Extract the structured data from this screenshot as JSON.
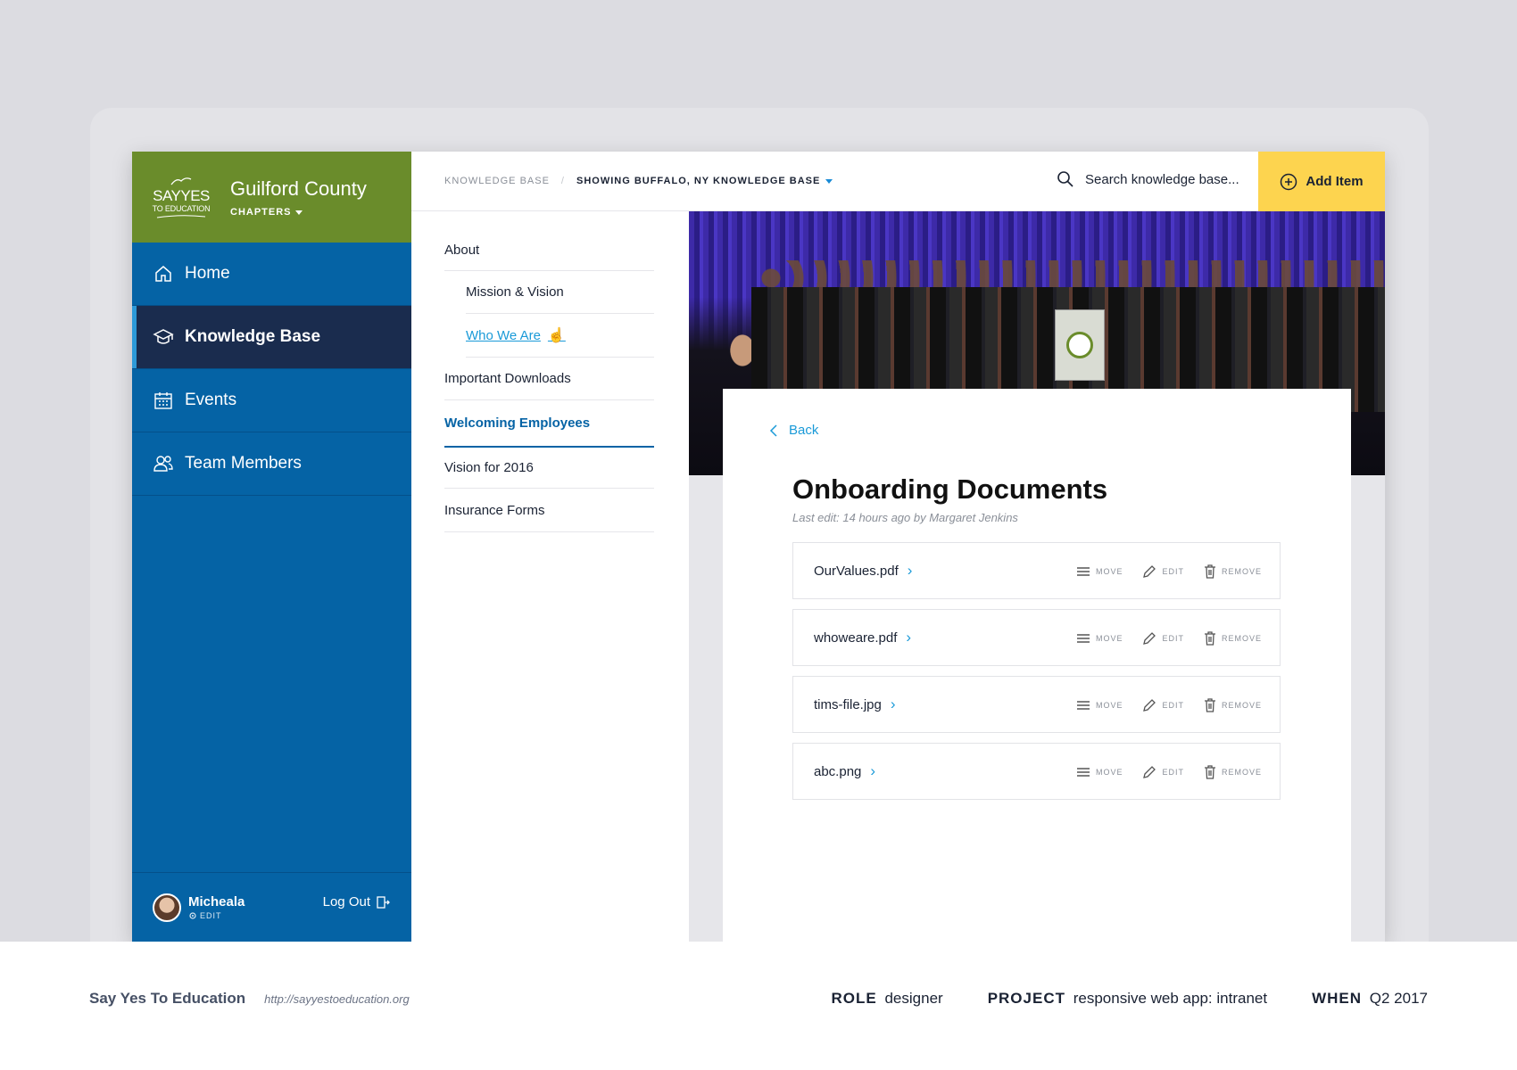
{
  "brand": {
    "logo_line1": "SAYYES",
    "logo_line2": "TO EDUCATION",
    "title": "Guilford County",
    "subtitle": "CHAPTERS"
  },
  "sidebar": {
    "items": [
      {
        "label": "Home",
        "icon": "home-icon"
      },
      {
        "label": "Knowledge Base",
        "icon": "graduation-cap-icon",
        "active": true
      },
      {
        "label": "Events",
        "icon": "calendar-icon"
      },
      {
        "label": "Team Members",
        "icon": "users-icon"
      }
    ],
    "user": {
      "name": "Micheala",
      "edit_label": "EDIT",
      "logout_label": "Log Out"
    }
  },
  "topbar": {
    "breadcrumb_root": "KNOWLEDGE BASE",
    "breadcrumb_current": "SHOWING BUFFALO, NY KNOWLEDGE BASE",
    "search_placeholder": "Search knowledge base...",
    "add_button_label": "Add Item"
  },
  "subnav": {
    "items": [
      {
        "label": "About"
      },
      {
        "label": "Mission & Vision",
        "child": true
      },
      {
        "label": "Who We Are",
        "child": true,
        "link": true
      },
      {
        "label": "Important Downloads"
      },
      {
        "label": "Welcoming Employees",
        "selected": true
      },
      {
        "label": "Vision for 2016"
      },
      {
        "label": "Insurance Forms"
      }
    ]
  },
  "document": {
    "back_label": "Back",
    "title": "Onboarding Documents",
    "meta": "Last edit: 14 hours ago by Margaret Jenkins",
    "files": [
      {
        "name": "OurValues.pdf"
      },
      {
        "name": "whoweare.pdf"
      },
      {
        "name": "tims-file.jpg"
      },
      {
        "name": "abc.png"
      }
    ],
    "actions": {
      "move": "MOVE",
      "edit": "EDIT",
      "remove": "REMOVE"
    }
  },
  "footer": {
    "company": "Say Yes To Education",
    "url": "http://sayyestoeducation.org",
    "role_label": "ROLE",
    "role_value": "designer",
    "project_label": "PROJECT",
    "project_value": "responsive web app: intranet",
    "when_label": "WHEN",
    "when_value": "Q2 2017"
  },
  "colors": {
    "sidebar_blue": "#0563a5",
    "brand_green": "#6a8c2b",
    "active_navy": "#1a2c4e",
    "accent_yellow": "#fdd44f",
    "link_blue": "#1a9ad8"
  }
}
